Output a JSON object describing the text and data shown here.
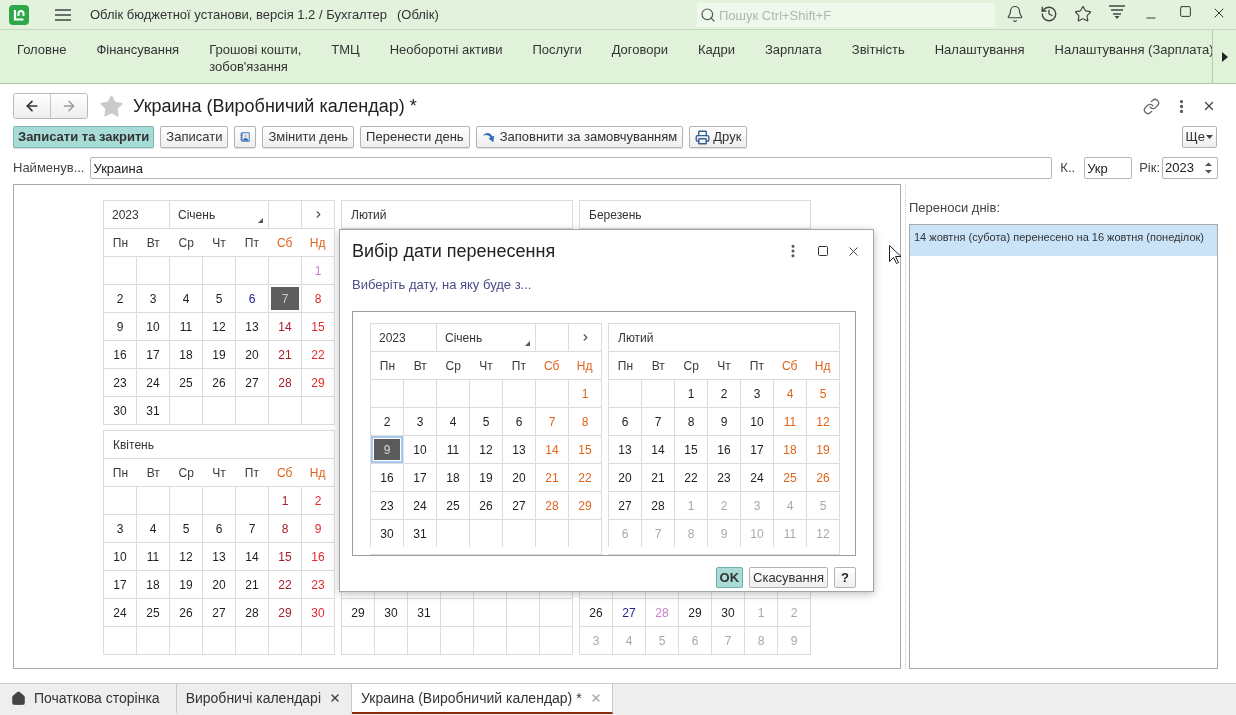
{
  "app_bar": {
    "title": "Облік бюджетної установи, версія 1.2 / Бухгалтер",
    "mode": "(Облік)",
    "search": {
      "placeholder": "Пошук Ctrl+Shift+F"
    }
  },
  "sections": [
    {
      "label": "Головне"
    },
    {
      "label": "Фінансування"
    },
    {
      "label": "Грошові кошти,\nзобов'язання"
    },
    {
      "label": "ТМЦ"
    },
    {
      "label": "Необоротні активи"
    },
    {
      "label": "Послуги"
    },
    {
      "label": "Договори"
    },
    {
      "label": "Кадри"
    },
    {
      "label": "Зарплата"
    },
    {
      "label": "Звітність"
    },
    {
      "label": "Налаштування"
    },
    {
      "label": "Налаштування (Зарплата)"
    }
  ],
  "form": {
    "nav": {
      "back": {
        "disabled": false
      },
      "forward": {
        "disabled": true
      }
    },
    "favorite": false,
    "title": "Украина (Виробничий календар) *",
    "toolbar": [
      {
        "kind": "primary",
        "label": "Записати та закрити"
      },
      {
        "kind": "plain",
        "label": "Записати"
      },
      {
        "kind": "addressbook"
      },
      {
        "kind": "plain",
        "label": "Змінити день"
      },
      {
        "kind": "plain",
        "label": "Перенести день"
      },
      {
        "kind": "autofill",
        "label": "Заповнити за замовчуванням"
      },
      {
        "kind": "print",
        "label": "Друк"
      }
    ],
    "more": {
      "label": "Ще"
    },
    "fields": {
      "name": {
        "label": "Найменув...",
        "value": "Украина"
      },
      "code": {
        "label": "К..",
        "value": "Укр"
      },
      "year": {
        "label": "Рік:",
        "value": "2023"
      }
    }
  },
  "calendars": [
    {
      "kind": "navigator",
      "year": "2023",
      "month": "Січень",
      "weekdays": [
        {
          "label": "Пн",
          "weekend": false
        },
        {
          "label": "Вт",
          "weekend": false
        },
        {
          "label": "Ср",
          "weekend": false
        },
        {
          "label": "Чт",
          "weekend": false
        },
        {
          "label": "Пт",
          "weekend": false
        },
        {
          "label": "Сб",
          "weekend": true
        },
        {
          "label": "Нд",
          "weekend": true
        }
      ],
      "weeks": [
        [
          {
            "kind": "blank"
          },
          {
            "kind": "blank"
          },
          {
            "kind": "blank"
          },
          {
            "kind": "blank"
          },
          {
            "kind": "blank"
          },
          {
            "kind": "blank"
          },
          {
            "day": "1",
            "kind": "holiday",
            "selected": false
          }
        ],
        [
          {
            "day": "2",
            "kind": "work",
            "selected": false
          },
          {
            "day": "3",
            "kind": "work",
            "selected": false
          },
          {
            "day": "4",
            "kind": "work",
            "selected": false
          },
          {
            "day": "5",
            "kind": "work",
            "selected": false
          },
          {
            "day": "6",
            "kind": "short",
            "selected": false
          },
          {
            "day": "7",
            "kind": "saturday",
            "selected": true
          },
          {
            "day": "8",
            "kind": "sunday",
            "selected": false
          }
        ],
        [
          {
            "day": "9",
            "kind": "work",
            "selected": false
          },
          {
            "day": "10",
            "kind": "work",
            "selected": false
          },
          {
            "day": "11",
            "kind": "work",
            "selected": false
          },
          {
            "day": "12",
            "kind": "work",
            "selected": false
          },
          {
            "day": "13",
            "kind": "work",
            "selected": false
          },
          {
            "day": "14",
            "kind": "saturday",
            "selected": false
          },
          {
            "day": "15",
            "kind": "sunday",
            "selected": false
          }
        ],
        [
          {
            "day": "16",
            "kind": "work",
            "selected": false
          },
          {
            "day": "17",
            "kind": "work",
            "selected": false
          },
          {
            "day": "18",
            "kind": "work",
            "selected": false
          },
          {
            "day": "19",
            "kind": "work",
            "selected": false
          },
          {
            "day": "20",
            "kind": "work",
            "selected": false
          },
          {
            "day": "21",
            "kind": "saturday",
            "selected": false
          },
          {
            "day": "22",
            "kind": "sunday",
            "selected": false
          }
        ],
        [
          {
            "day": "23",
            "kind": "work",
            "selected": false
          },
          {
            "day": "24",
            "kind": "work",
            "selected": false
          },
          {
            "day": "25",
            "kind": "work",
            "selected": false
          },
          {
            "day": "26",
            "kind": "work",
            "selected": false
          },
          {
            "day": "27",
            "kind": "work",
            "selected": false
          },
          {
            "day": "28",
            "kind": "saturday",
            "selected": false
          },
          {
            "day": "29",
            "kind": "sunday",
            "selected": false
          }
        ],
        [
          {
            "day": "30",
            "kind": "work",
            "selected": false
          },
          {
            "day": "31",
            "kind": "work",
            "selected": false
          },
          {
            "kind": "blank"
          },
          {
            "kind": "blank"
          },
          {
            "kind": "blank"
          },
          {
            "kind": "blank"
          },
          {
            "kind": "blank"
          }
        ]
      ]
    },
    {
      "kind": "month",
      "month": "Лютий"
    },
    {
      "kind": "month",
      "month": "Березень"
    },
    {
      "kind": "month",
      "month": "Квітень",
      "weekdays": [
        {
          "label": "Пн",
          "weekend": false
        },
        {
          "label": "Вт",
          "weekend": false
        },
        {
          "label": "Ср",
          "weekend": false
        },
        {
          "label": "Чт",
          "weekend": false
        },
        {
          "label": "Пт",
          "weekend": false
        },
        {
          "label": "Сб",
          "weekend": true
        },
        {
          "label": "Нд",
          "weekend": true
        }
      ],
      "weeks": [
        [
          {
            "kind": "blank"
          },
          {
            "kind": "blank"
          },
          {
            "kind": "blank"
          },
          {
            "kind": "blank"
          },
          {
            "kind": "blank"
          },
          {
            "day": "1",
            "kind": "saturday",
            "selected": false
          },
          {
            "day": "2",
            "kind": "sunday",
            "selected": false
          }
        ],
        [
          {
            "day": "3",
            "kind": "work",
            "selected": false
          },
          {
            "day": "4",
            "kind": "work",
            "selected": false
          },
          {
            "day": "5",
            "kind": "work",
            "selected": false
          },
          {
            "day": "6",
            "kind": "work",
            "selected": false
          },
          {
            "day": "7",
            "kind": "work",
            "selected": false
          },
          {
            "day": "8",
            "kind": "saturday",
            "selected": false
          },
          {
            "day": "9",
            "kind": "sunday",
            "selected": false
          }
        ],
        [
          {
            "day": "10",
            "kind": "work",
            "selected": false
          },
          {
            "day": "11",
            "kind": "work",
            "selected": false
          },
          {
            "day": "12",
            "kind": "work",
            "selected": false
          },
          {
            "day": "13",
            "kind": "work",
            "selected": false
          },
          {
            "day": "14",
            "kind": "work",
            "selected": false
          },
          {
            "day": "15",
            "kind": "saturday",
            "selected": false
          },
          {
            "day": "16",
            "kind": "sunday",
            "selected": false
          }
        ],
        [
          {
            "day": "17",
            "kind": "work",
            "selected": false
          },
          {
            "day": "18",
            "kind": "work",
            "selected": false
          },
          {
            "day": "19",
            "kind": "work",
            "selected": false
          },
          {
            "day": "20",
            "kind": "work",
            "selected": false
          },
          {
            "day": "21",
            "kind": "work",
            "selected": false
          },
          {
            "day": "22",
            "kind": "saturday",
            "selected": false
          },
          {
            "day": "23",
            "kind": "sunday",
            "selected": false
          }
        ],
        [
          {
            "day": "24",
            "kind": "work",
            "selected": false
          },
          {
            "day": "25",
            "kind": "work",
            "selected": false
          },
          {
            "day": "26",
            "kind": "work",
            "selected": false
          },
          {
            "day": "27",
            "kind": "work",
            "selected": false
          },
          {
            "day": "28",
            "kind": "work",
            "selected": false
          },
          {
            "day": "29",
            "kind": "saturday",
            "selected": false
          },
          {
            "day": "30",
            "kind": "sunday",
            "selected": false
          }
        ],
        [
          {
            "kind": "blank"
          },
          {
            "kind": "blank"
          },
          {
            "kind": "blank"
          },
          {
            "kind": "blank"
          },
          {
            "kind": "blank"
          },
          {
            "kind": "blank"
          },
          {
            "kind": "blank"
          }
        ]
      ]
    },
    {
      "kind": "month",
      "weeks": [
        [
          {
            "day": "29",
            "kind": "work",
            "selected": false
          },
          {
            "day": "30",
            "kind": "work",
            "selected": false
          },
          {
            "day": "31",
            "kind": "work",
            "selected": false
          },
          {
            "kind": "blank"
          },
          {
            "kind": "blank"
          },
          {
            "kind": "blank"
          },
          {
            "kind": "blank"
          }
        ],
        [
          {
            "kind": "blank"
          },
          {
            "kind": "blank"
          },
          {
            "kind": "blank"
          },
          {
            "kind": "blank"
          },
          {
            "kind": "blank"
          },
          {
            "kind": "blank"
          },
          {
            "kind": "blank"
          }
        ]
      ]
    },
    {
      "kind": "month",
      "weeks": [
        [
          {
            "day": "26",
            "kind": "work",
            "selected": false
          },
          {
            "day": "27",
            "kind": "short",
            "selected": false
          },
          {
            "day": "28",
            "kind": "holiday",
            "selected": false
          },
          {
            "day": "29",
            "kind": "work",
            "selected": false
          },
          {
            "day": "30",
            "kind": "work",
            "selected": false
          },
          {
            "day": "1",
            "kind": "other",
            "selected": false
          },
          {
            "day": "2",
            "kind": "other",
            "selected": false
          }
        ],
        [
          {
            "day": "3",
            "kind": "other",
            "selected": false
          },
          {
            "day": "4",
            "kind": "other",
            "selected": false
          },
          {
            "day": "5",
            "kind": "other",
            "selected": false
          },
          {
            "day": "6",
            "kind": "other",
            "selected": false
          },
          {
            "day": "7",
            "kind": "other",
            "selected": false
          },
          {
            "day": "8",
            "kind": "other",
            "selected": false
          },
          {
            "day": "9",
            "kind": "other",
            "selected": false
          }
        ]
      ]
    }
  ],
  "transfers": {
    "label": "Переноси днів:",
    "items": [
      {
        "text": "14 жовтня (субота) перенесено на 16 жовтня (понеділок)",
        "selected": true
      }
    ]
  },
  "dialog": {
    "title": "Вибір дати перенесення",
    "prompt": "Виберіть дату, на яку буде з...",
    "calendars": [
      {
        "kind": "navigator",
        "year": "2023",
        "month": "Січень",
        "weekdays": [
          {
            "label": "Пн",
            "weekend": false
          },
          {
            "label": "Вт",
            "weekend": false
          },
          {
            "label": "Ср",
            "weekend": false
          },
          {
            "label": "Чт",
            "weekend": false
          },
          {
            "label": "Пт",
            "weekend": false
          },
          {
            "label": "Сб",
            "weekend": true
          },
          {
            "label": "Нд",
            "weekend": true
          }
        ],
        "weeks": [
          [
            {
              "kind": "blank"
            },
            {
              "kind": "blank"
            },
            {
              "kind": "blank"
            },
            {
              "kind": "blank"
            },
            {
              "kind": "blank"
            },
            {
              "kind": "blank"
            },
            {
              "day": "1",
              "kind": "weekend",
              "selected": false
            }
          ],
          [
            {
              "day": "2",
              "kind": "work",
              "selected": false
            },
            {
              "day": "3",
              "kind": "work",
              "selected": false
            },
            {
              "day": "4",
              "kind": "work",
              "selected": false
            },
            {
              "day": "5",
              "kind": "work",
              "selected": false
            },
            {
              "day": "6",
              "kind": "work",
              "selected": false
            },
            {
              "day": "7",
              "kind": "weekend",
              "selected": false
            },
            {
              "day": "8",
              "kind": "weekend",
              "selected": false
            }
          ],
          [
            {
              "day": "9",
              "kind": "work",
              "selected": true
            },
            {
              "day": "10",
              "kind": "work",
              "selected": false
            },
            {
              "day": "11",
              "kind": "work",
              "selected": false
            },
            {
              "day": "12",
              "kind": "work",
              "selected": false
            },
            {
              "day": "13",
              "kind": "work",
              "selected": false
            },
            {
              "day": "14",
              "kind": "weekend",
              "selected": false
            },
            {
              "day": "15",
              "kind": "weekend",
              "selected": false
            }
          ],
          [
            {
              "day": "16",
              "kind": "work",
              "selected": false
            },
            {
              "day": "17",
              "kind": "work",
              "selected": false
            },
            {
              "day": "18",
              "kind": "work",
              "selected": false
            },
            {
              "day": "19",
              "kind": "work",
              "selected": false
            },
            {
              "day": "20",
              "kind": "work",
              "selected": false
            },
            {
              "day": "21",
              "kind": "weekend",
              "selected": false
            },
            {
              "day": "22",
              "kind": "weekend",
              "selected": false
            }
          ],
          [
            {
              "day": "23",
              "kind": "work",
              "selected": false
            },
            {
              "day": "24",
              "kind": "work",
              "selected": false
            },
            {
              "day": "25",
              "kind": "work",
              "selected": false
            },
            {
              "day": "26",
              "kind": "work",
              "selected": false
            },
            {
              "day": "27",
              "kind": "work",
              "selected": false
            },
            {
              "day": "28",
              "kind": "weekend",
              "selected": false
            },
            {
              "day": "29",
              "kind": "weekend",
              "selected": false
            }
          ],
          [
            {
              "day": "30",
              "kind": "work",
              "selected": false
            },
            {
              "day": "31",
              "kind": "work",
              "selected": false
            },
            {
              "kind": "blank"
            },
            {
              "kind": "blank"
            },
            {
              "kind": "blank"
            },
            {
              "kind": "blank"
            },
            {
              "kind": "blank"
            }
          ]
        ]
      },
      {
        "kind": "month",
        "month": "Лютий",
        "weekdays": [
          {
            "label": "Пн",
            "weekend": false
          },
          {
            "label": "Вт",
            "weekend": false
          },
          {
            "label": "Ср",
            "weekend": false
          },
          {
            "label": "Чт",
            "weekend": false
          },
          {
            "label": "Пт",
            "weekend": false
          },
          {
            "label": "Сб",
            "weekend": true
          },
          {
            "label": "Нд",
            "weekend": true
          }
        ],
        "weeks": [
          [
            {
              "kind": "blank"
            },
            {
              "kind": "blank"
            },
            {
              "day": "1",
              "kind": "work",
              "selected": false
            },
            {
              "day": "2",
              "kind": "work",
              "selected": false
            },
            {
              "day": "3",
              "kind": "work",
              "selected": false
            },
            {
              "day": "4",
              "kind": "weekend",
              "selected": false
            },
            {
              "day": "5",
              "kind": "weekend",
              "selected": false
            }
          ],
          [
            {
              "day": "6",
              "kind": "work",
              "selected": false
            },
            {
              "day": "7",
              "kind": "work",
              "selected": false
            },
            {
              "day": "8",
              "kind": "work",
              "selected": false
            },
            {
              "day": "9",
              "kind": "work",
              "selected": false
            },
            {
              "day": "10",
              "kind": "work",
              "selected": false
            },
            {
              "day": "11",
              "kind": "weekend",
              "selected": false
            },
            {
              "day": "12",
              "kind": "weekend",
              "selected": false
            }
          ],
          [
            {
              "day": "13",
              "kind": "work",
              "selected": false
            },
            {
              "day": "14",
              "kind": "work",
              "selected": false
            },
            {
              "day": "15",
              "kind": "work",
              "selected": false
            },
            {
              "day": "16",
              "kind": "work",
              "selected": false
            },
            {
              "day": "17",
              "kind": "work",
              "selected": false
            },
            {
              "day": "18",
              "kind": "weekend",
              "selected": false
            },
            {
              "day": "19",
              "kind": "weekend",
              "selected": false
            }
          ],
          [
            {
              "day": "20",
              "kind": "work",
              "selected": false
            },
            {
              "day": "21",
              "kind": "work",
              "selected": false
            },
            {
              "day": "22",
              "kind": "work",
              "selected": false
            },
            {
              "day": "23",
              "kind": "work",
              "selected": false
            },
            {
              "day": "24",
              "kind": "work",
              "selected": false
            },
            {
              "day": "25",
              "kind": "weekend",
              "selected": false
            },
            {
              "day": "26",
              "kind": "weekend",
              "selected": false
            }
          ],
          [
            {
              "day": "27",
              "kind": "work",
              "selected": false
            },
            {
              "day": "28",
              "kind": "work",
              "selected": false
            },
            {
              "day": "1",
              "kind": "other",
              "selected": false
            },
            {
              "day": "2",
              "kind": "other",
              "selected": false
            },
            {
              "day": "3",
              "kind": "other",
              "selected": false
            },
            {
              "day": "4",
              "kind": "other",
              "selected": false
            },
            {
              "day": "5",
              "kind": "other",
              "selected": false
            }
          ],
          [
            {
              "day": "6",
              "kind": "other",
              "selected": false
            },
            {
              "day": "7",
              "kind": "other",
              "selected": false
            },
            {
              "day": "8",
              "kind": "other",
              "selected": false
            },
            {
              "day": "9",
              "kind": "other",
              "selected": false
            },
            {
              "day": "10",
              "kind": "other",
              "selected": false
            },
            {
              "day": "11",
              "kind": "other",
              "selected": false
            },
            {
              "day": "12",
              "kind": "other",
              "selected": false
            }
          ]
        ]
      }
    ],
    "buttons": [
      {
        "kind": "default",
        "label": "OK"
      },
      {
        "kind": "plain",
        "label": "Скасування"
      },
      {
        "kind": "help",
        "label": "?"
      }
    ]
  },
  "tabs": [
    {
      "kind": "home",
      "label": "Початкова сторінка",
      "selected": false
    },
    {
      "kind": "closable",
      "label": "Виробничі календарі",
      "selected": false
    },
    {
      "kind": "closable",
      "label": "Украина (Виробничий календар) *",
      "selected": true
    }
  ]
}
